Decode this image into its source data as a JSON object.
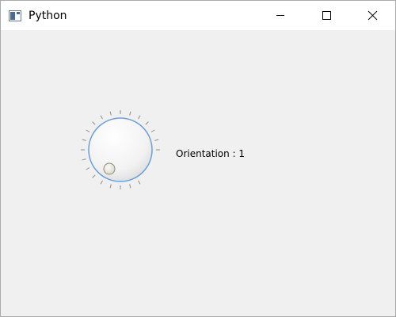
{
  "window": {
    "title": "Python",
    "app_icon": "python-window-icon",
    "controls": {
      "minimize_icon": "minimize-icon",
      "maximize_icon": "maximize-icon",
      "close_icon": "close-icon"
    }
  },
  "dial": {
    "value": 1,
    "notches_visible": true,
    "accent_color": "#6a9fd8"
  },
  "label": {
    "text": "Orientation : 1"
  }
}
